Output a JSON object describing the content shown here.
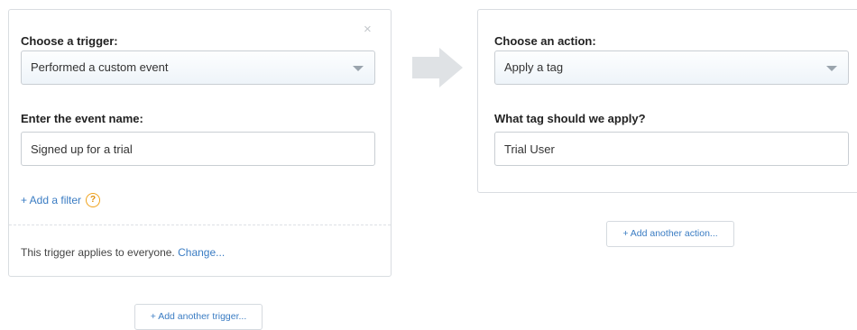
{
  "trigger": {
    "heading": "Choose a trigger:",
    "selected": "Performed a custom event",
    "event_label": "Enter the event name:",
    "event_value": "Signed up for a trial",
    "close": "×",
    "add_filter": "+ Add a filter",
    "help": "?",
    "applies_text": "This trigger applies to everyone.",
    "change_link": "Change...",
    "add_another": "+ Add another trigger..."
  },
  "action": {
    "heading": "Choose an action:",
    "selected": "Apply a tag",
    "tag_label": "What tag should we apply?",
    "tag_value": "Trial User",
    "add_another": "+ Add another action..."
  },
  "colors": {
    "link": "#3a7cc3",
    "help_accent": "#f0a31d",
    "arrow": "#dfe2e5"
  }
}
